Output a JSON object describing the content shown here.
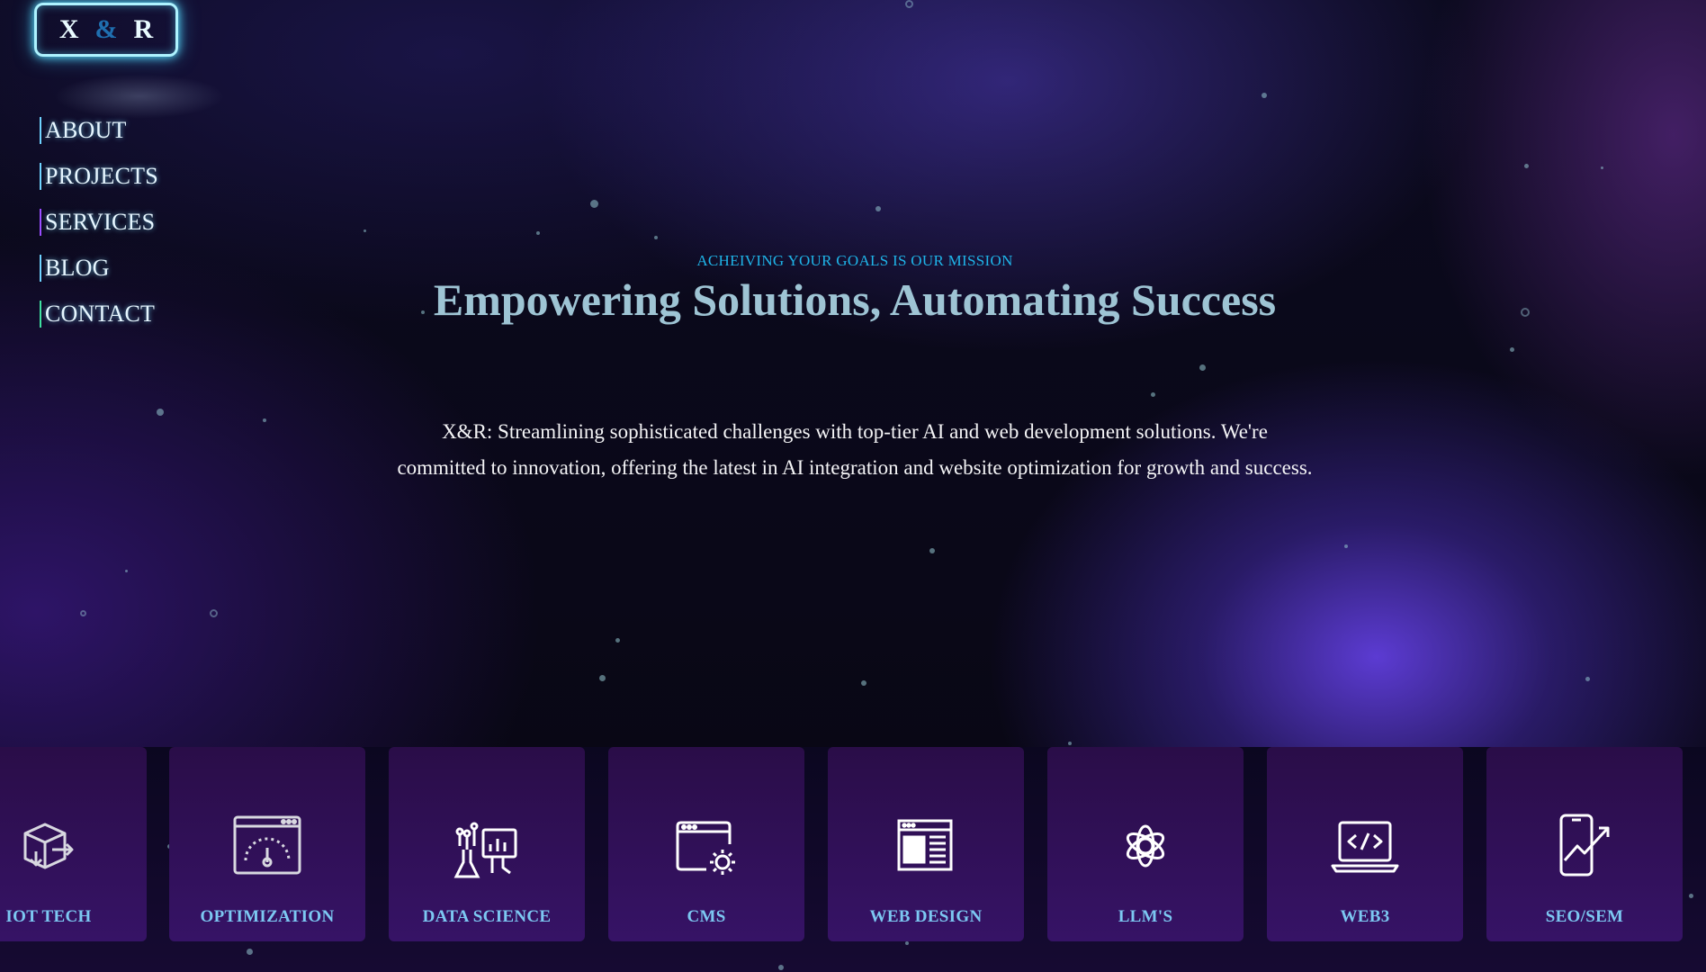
{
  "logo": {
    "left": "X",
    "amp": "&",
    "right": "R"
  },
  "nav": {
    "items": [
      {
        "label": "ABOUT"
      },
      {
        "label": "PROJECTS"
      },
      {
        "label": "SERVICES"
      },
      {
        "label": "BLOG"
      },
      {
        "label": "CONTACT"
      }
    ]
  },
  "hero": {
    "tagline": "ACHEIVING YOUR GOALS IS OUR MISSION",
    "headline": "Empowering Solutions, Automating Success",
    "description": "X&R: Streamlining sophisticated challenges with top-tier AI and web development solutions. We're committed to innovation, offering the latest in AI integration and website optimization for growth and success."
  },
  "services": [
    {
      "label": "IOT TECH",
      "icon": "cube-icon"
    },
    {
      "label": "OPTIMIZATION",
      "icon": "speedometer-icon"
    },
    {
      "label": "DATA SCIENCE",
      "icon": "data-science-icon"
    },
    {
      "label": "CMS",
      "icon": "browser-gear-icon"
    },
    {
      "label": "WEB DESIGN",
      "icon": "web-layout-icon"
    },
    {
      "label": "LLM'S",
      "icon": "openai-icon"
    },
    {
      "label": "WEB3",
      "icon": "laptop-code-icon"
    },
    {
      "label": "SEO/SEM",
      "icon": "phone-growth-icon"
    }
  ],
  "colors": {
    "accent_cyan": "#1fb4e8",
    "logo_border": "#aef3ff",
    "card_bg": "#2e0f55",
    "card_label": "#7cc8f2",
    "glow_purple": "#603edc"
  }
}
